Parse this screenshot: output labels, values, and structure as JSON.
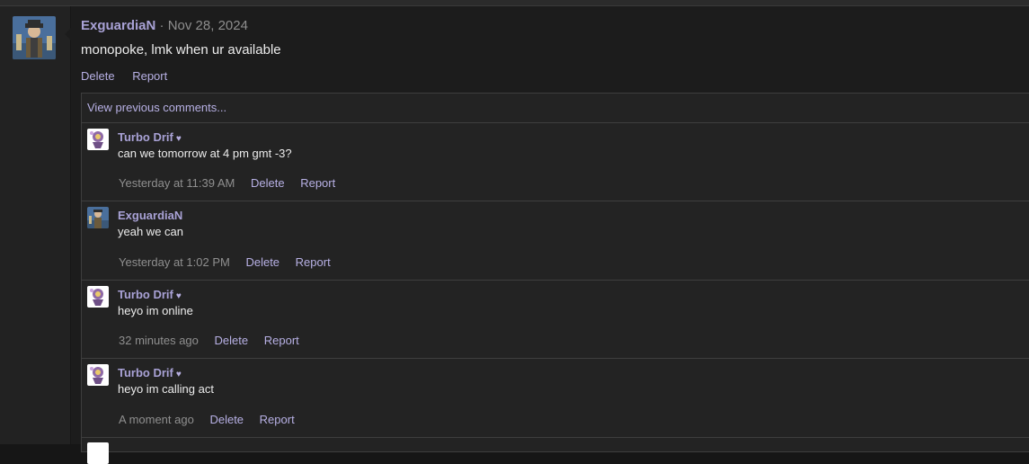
{
  "post": {
    "author": "ExguardiaN",
    "separator": "·",
    "date": "Nov 28, 2024",
    "body": "monopoke, lmk when ur available",
    "actions": [
      "Delete",
      "Report"
    ]
  },
  "comments_section": {
    "view_previous": "View previous comments...",
    "items": [
      {
        "author": "Turbo Drif",
        "heart": "♥",
        "text": "can we tomorrow at 4 pm gmt -3?",
        "time": "Yesterday at 11:39 AM",
        "delete": "Delete",
        "report": "Report"
      },
      {
        "author": "ExguardiaN",
        "heart": "",
        "text": "yeah we can",
        "time": "Yesterday at 1:02 PM",
        "delete": "Delete",
        "report": "Report"
      },
      {
        "author": "Turbo Drif",
        "heart": "♥",
        "text": "heyo im online",
        "time": "32 minutes ago",
        "delete": "Delete",
        "report": "Report"
      },
      {
        "author": "Turbo Drif",
        "heart": "♥",
        "text": "heyo im calling act",
        "time": "A moment ago",
        "delete": "Delete",
        "report": "Report"
      }
    ]
  },
  "colors": {
    "accent_link": "#b7b0e4",
    "author_name": "#a9a2d6",
    "background": "#1c1c1c"
  }
}
